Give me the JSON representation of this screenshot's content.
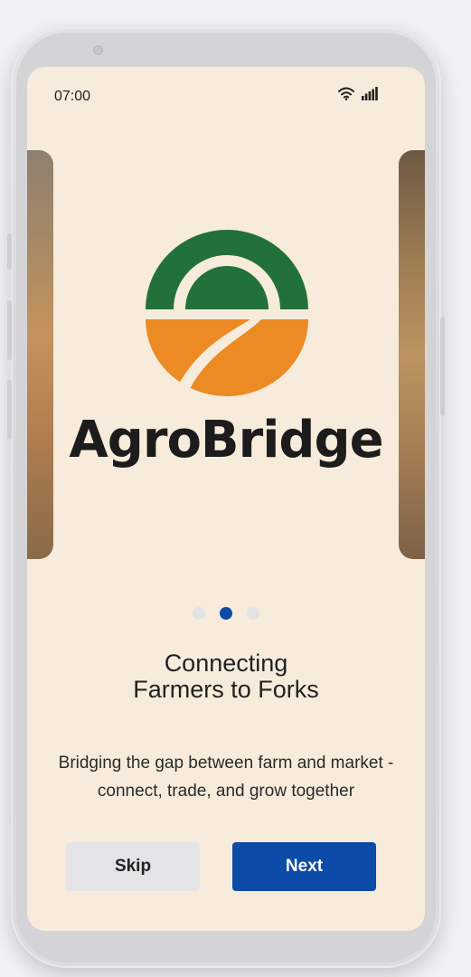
{
  "status_bar": {
    "time": "07:00",
    "wifi_icon": "wifi-icon",
    "signal_icon": "cellular-signal-icon"
  },
  "brand": {
    "name": "AgroBridge",
    "logo_icon": "agrobridge-logo",
    "colors": {
      "green": "#23713a",
      "orange": "#ec8a24",
      "cream": "#f7ecdb"
    }
  },
  "carousel": {
    "page_count": 3,
    "active_index": 1,
    "active_color": "#0c4ba8",
    "inactive_color": "#e3e3e6"
  },
  "onboarding": {
    "headline_line1": "Connecting",
    "headline_line2": "Farmers to Forks",
    "description": "Bridging the gap between farm and market -  connect, trade, and grow together"
  },
  "actions": {
    "skip_label": "Skip",
    "next_label": "Next",
    "primary_color": "#0c4ba8"
  }
}
